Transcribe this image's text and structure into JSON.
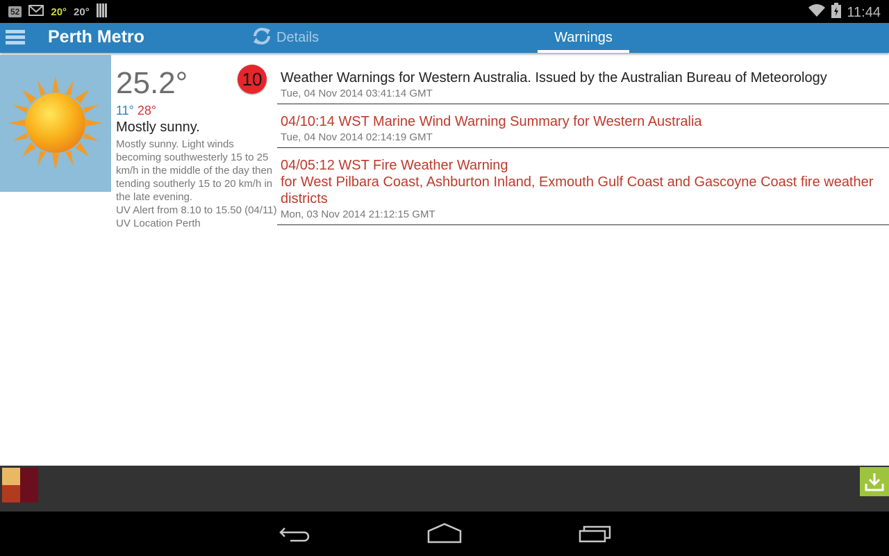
{
  "status_bar": {
    "notification_badge": "52",
    "temp_yellow": "20°",
    "temp_white": "20°",
    "time": "11:44"
  },
  "action_bar": {
    "title": "Perth Metro",
    "tabs": [
      {
        "label": "Details",
        "selected": false
      },
      {
        "label": "Warnings",
        "selected": true
      }
    ]
  },
  "weather": {
    "current_temp": "25.2°",
    "min_temp": "11°",
    "max_temp": "28°",
    "condition": "Mostly sunny.",
    "description": "Mostly sunny. Light winds becoming southwesterly 15 to 25 km/h in the middle of the day then tending southerly 15 to 20 km/h in the late evening.",
    "uv_alert": "UV Alert from 8.10 to 15.50 (04/11)",
    "uv_location": "UV Location Perth"
  },
  "warning_count": "10",
  "warnings": [
    {
      "title": "Weather Warnings for Western Australia. Issued by the Australian Bureau of Meteorology",
      "date": "Tue, 04 Nov 2014 03:41:14 GMT",
      "type": "info"
    },
    {
      "title": "04/10:14 WST Marine Wind Warning Summary for Western Australia",
      "date": "Tue, 04 Nov 2014 02:14:19 GMT",
      "type": "alert"
    },
    {
      "title": "04/05:12 WST Fire Weather Warning",
      "title_line2": "for West Pilbara Coast, Ashburton Inland, Exmouth Gulf Coast and Gascoyne Coast fire weather districts",
      "date": "Mon, 03 Nov 2014 21:12:15 GMT",
      "type": "alert"
    }
  ],
  "colors": {
    "action_bar": "#2a81bd",
    "alert_text": "#c0392b",
    "badge": "#e6262b",
    "download": "#9ec43d"
  }
}
